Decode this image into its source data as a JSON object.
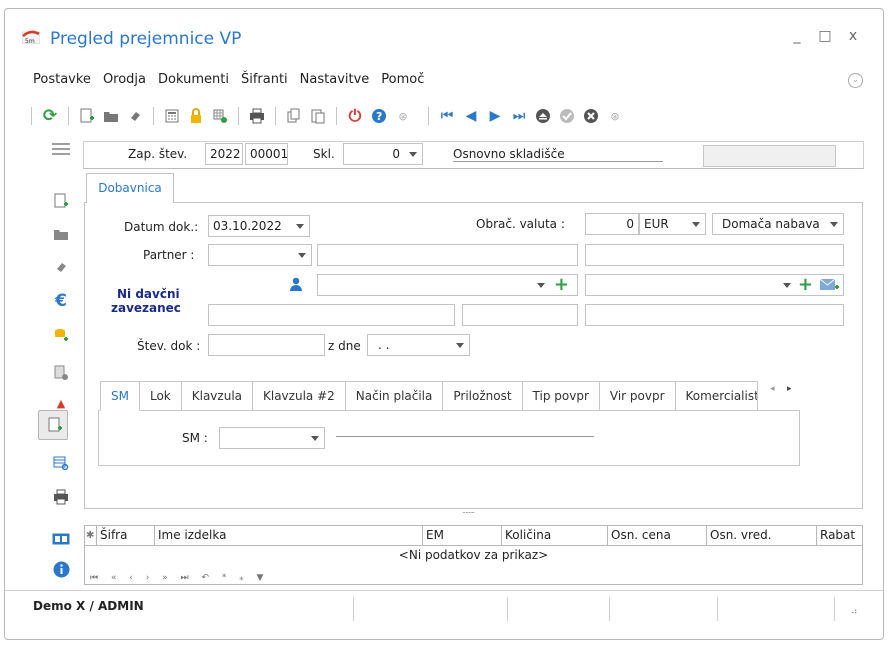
{
  "window": {
    "title": "Pregled prejemnice VP",
    "minimize": "_",
    "maximize": "□",
    "close": "x"
  },
  "menu": [
    "Postavke",
    "Orodja",
    "Dokumenti",
    "Šifranti",
    "Nastavitve",
    "Pomoč"
  ],
  "header": {
    "zap_label": "Zap. štev.",
    "zap_year": "2022",
    "zap_number": "00001",
    "skl_label": "Skl.",
    "skl_value": "0",
    "skl_name": "Osnovno skladišče"
  },
  "tab_main": "Dobavnica",
  "form": {
    "datum_label": "Datum dok.:",
    "datum_value": "03.10.2022",
    "valuta_label": "Obrač. valuta :",
    "valuta_rate": "0",
    "valuta_code": "EUR",
    "nabava_value": "Domača nabava",
    "partner_label": "Partner :",
    "ni_davcni_line1": "Ni davčni",
    "ni_davcni_line2": "zavezanec",
    "stev_dok_label": "Štev. dok :",
    "z_dne_label": "z dne",
    "z_dne_value": ". ."
  },
  "subtabs": [
    "SM",
    "Lok",
    "Klavzula",
    "Klavzula #2",
    "Način plačila",
    "Priložnost",
    "Tip povpr",
    "Vir povpr",
    "Komercialist"
  ],
  "sm_label": "SM :",
  "splitter_dots": "........",
  "grid": {
    "columns": [
      "Šifra",
      "Ime izdelka",
      "EM",
      "Količina",
      "Osn. cena",
      "Osn. vred.",
      "Rabat"
    ],
    "empty_text": "<Ni podatkov za prikaz>",
    "nav": [
      "⏮",
      "«",
      "‹",
      "›",
      "»",
      "⏭",
      "↶",
      "*",
      "⁎",
      "▼"
    ]
  },
  "status": {
    "user": "Demo X / ADMIN"
  },
  "colors": {
    "accent": "#2a78c9",
    "green": "#2ea043",
    "red": "#d63b2f",
    "navy": "#1a2a8a"
  }
}
